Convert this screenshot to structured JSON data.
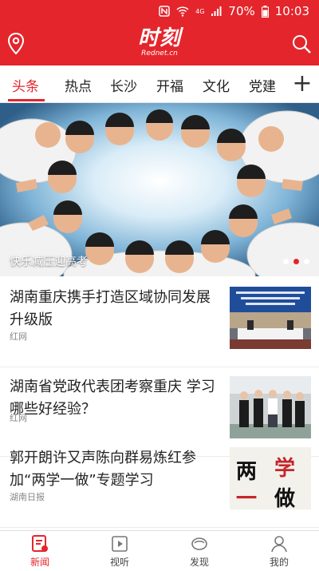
{
  "status_bar": {
    "network": "4G",
    "battery": "70%",
    "time": "10:03"
  },
  "app": {
    "logo_text": "时刻",
    "logo_subtext": "Rednet.cn"
  },
  "tabs": [
    "头条",
    "热点",
    "长沙",
    "开福",
    "文化",
    "党建"
  ],
  "tab_add_label": "+",
  "banner": {
    "caption": "快乐减压迎高考"
  },
  "news": [
    {
      "title": "湖南重庆携手打造区域协同发展升级版",
      "source": "红网"
    },
    {
      "title": "湖南省党政代表团考察重庆 学习哪些好经验？",
      "source": "红网"
    },
    {
      "title": "郭开朗许又声陈向群易炼红参加“两学一做”专题学习",
      "source": "湖南日报"
    }
  ],
  "thumb3_text": [
    "两",
    "学",
    "一",
    "做"
  ],
  "bottom_nav": [
    "新闻",
    "视听",
    "发现",
    "我的"
  ],
  "colors": {
    "brand_red": "#e4252c",
    "text_dark": "#222222",
    "text_gray": "#888888"
  }
}
